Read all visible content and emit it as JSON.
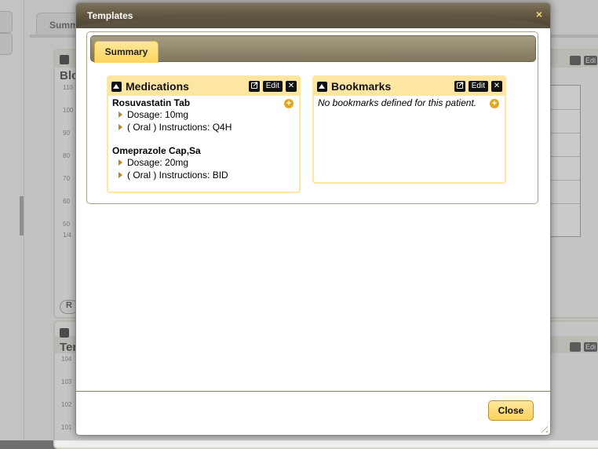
{
  "dialog": {
    "title": "Templates",
    "close_icon": "×",
    "close_button_label": "Close"
  },
  "tabs": [
    {
      "label": "Summary",
      "active": true
    }
  ],
  "medications": {
    "title": "Medications",
    "edit_label": "Edit",
    "items": [
      {
        "name": "Rosuvastatin Tab",
        "dosage": "Dosage: 10mg",
        "instructions": "( Oral ) Instructions: Q4H"
      },
      {
        "name": "Omeprazole Cap,Sa",
        "dosage": "Dosage: 20mg",
        "instructions": "( Oral ) Instructions: BID"
      }
    ]
  },
  "bookmarks": {
    "title": "Bookmarks",
    "edit_label": "Edit",
    "empty_message": "No bookmarks defined for this patient."
  },
  "background": {
    "tab_label": "Summ",
    "panel1_title": "Blo",
    "panel2_title": "Ten",
    "edit_label": "Edi",
    "r_button": "R",
    "ticks1": [
      "110",
      "100",
      "90",
      "80",
      "70",
      "60",
      "50",
      "1/4"
    ],
    "ticks2": [
      "104",
      "103",
      "102",
      "101"
    ]
  },
  "colors": {
    "accent": "#fde6a1",
    "button": "#fcd45a",
    "titlebar": "#5d533f"
  },
  "icons": {
    "collapse": "triangle-up-icon",
    "external": "external-link-icon",
    "remove": "close-icon",
    "add": "plus-circle-icon"
  }
}
